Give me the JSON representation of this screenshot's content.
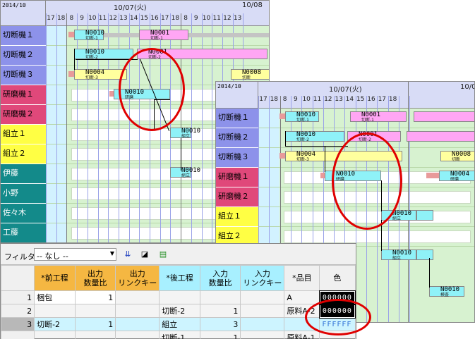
{
  "gantt_back": {
    "corner": "2014/10",
    "dates": [
      "10/07(火)",
      "10/08"
    ],
    "hours": [
      "17",
      "18",
      "8",
      "9",
      "10",
      "11",
      "12",
      "13",
      "14",
      "15",
      "16",
      "17",
      "18",
      "8",
      "9",
      "10",
      "11",
      "12",
      "13"
    ],
    "rows": [
      "切断機１",
      "切断機２",
      "切断機３",
      "研磨機１",
      "研磨機２",
      "組立１",
      "組立２",
      "伊藤",
      "小野",
      "佐々木",
      "工藤"
    ],
    "bars": [
      {
        "code": "N0010",
        "sub": "切断-1"
      },
      {
        "code": "N0001",
        "sub": "切断-1"
      },
      {
        "code": "N0010",
        "sub": "切断-2"
      },
      {
        "code": "N0001",
        "sub": "切断-2"
      },
      {
        "code": "N0004",
        "sub": "切断-3"
      },
      {
        "code": "N0008",
        "sub": "切断"
      },
      {
        "code": "N0010",
        "sub": "研磨"
      },
      {
        "code": "N0010",
        "sub": "組立"
      },
      {
        "code": "N0010",
        "sub": "組立"
      }
    ]
  },
  "gantt_front": {
    "corner": "2014/10",
    "dates": [
      "10/07(火)",
      "10/08"
    ],
    "hours": [
      "17",
      "18",
      "8",
      "9",
      "10",
      "11",
      "12",
      "13",
      "14",
      "15",
      "16",
      "17",
      "18"
    ],
    "rows": [
      "切断機１",
      "切断機２",
      "切断機３",
      "研磨機１",
      "研磨機２",
      "組立１",
      "組立２"
    ],
    "bars": [
      {
        "code": "N0010",
        "sub": "切断-1"
      },
      {
        "code": "N0001",
        "sub": "切断-1"
      },
      {
        "code": "N0010",
        "sub": "切断-2"
      },
      {
        "code": "N0001",
        "sub": "切断-2"
      },
      {
        "code": "N0004",
        "sub": "切断-3"
      },
      {
        "code": "N0008",
        "sub": "切断"
      },
      {
        "code": "N0010",
        "sub": "研磨"
      },
      {
        "code": "N0004",
        "sub": "研磨"
      },
      {
        "code": "N0010",
        "sub": "組立"
      },
      {
        "code": "N0010",
        "sub": "組立"
      },
      {
        "code": "N0010",
        "sub": "検査"
      }
    ]
  },
  "toolbar": {
    "filter_label": "フィルタ",
    "filter_value": "-- なし --",
    "btn1": "⇊",
    "btn2": "◪",
    "btn3": "▤"
  },
  "table": {
    "headers": [
      "*前工程",
      "出力\n数量比",
      "出力\nリンクキー",
      "*後工程",
      "入力\n数量比",
      "入力\nリンクキー",
      "*品目",
      "色"
    ],
    "rows": [
      {
        "n": "1",
        "prev": "梱包",
        "out_ratio": "1",
        "out_key": "",
        "next": "",
        "in_ratio": "",
        "in_key": "",
        "item": "A",
        "color": "000000"
      },
      {
        "n": "2",
        "prev": "",
        "out_ratio": "",
        "out_key": "",
        "next": "切断-2",
        "in_ratio": "1",
        "in_key": "",
        "item": "原料A-2",
        "color": "000000"
      },
      {
        "n": "3",
        "prev": "切断-2",
        "out_ratio": "1",
        "out_key": "",
        "next": "組立",
        "in_ratio": "3",
        "in_key": "",
        "item": "",
        "color": "FFFFFF"
      },
      {
        "n": "",
        "prev": "",
        "out_ratio": "",
        "out_key": "",
        "next": "切断-1",
        "in_ratio": "1",
        "in_key": "",
        "item": "原料A-1",
        "color": ""
      }
    ]
  }
}
